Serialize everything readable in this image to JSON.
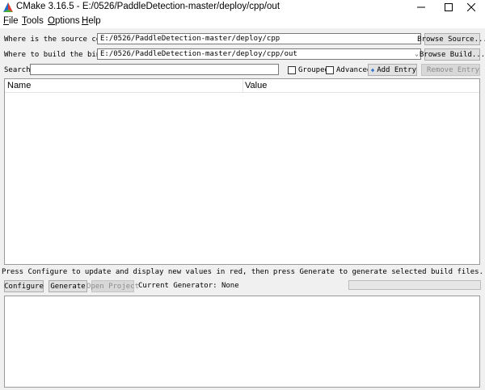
{
  "window": {
    "title": "CMake 3.16.5 - E:/0526/PaddleDetection-master/deploy/cpp/out",
    "icon": "cmake-triangle-icon"
  },
  "menu": {
    "items": [
      {
        "label": "File",
        "accel": "F",
        "rest": "ile"
      },
      {
        "label": "Tools",
        "accel": "T",
        "rest": "ools"
      },
      {
        "label": "Options",
        "accel": "O",
        "rest": "ptions"
      },
      {
        "label": "Help",
        "accel": "H",
        "rest": "elp"
      }
    ]
  },
  "source": {
    "label": "Where is the source code:",
    "value": "E:/0526/PaddleDetection-master/deploy/cpp",
    "browse_label": "Browse Source..."
  },
  "build": {
    "label": "Where to build the binaries:",
    "value": "E:/0526/PaddleDetection-master/deploy/cpp/out",
    "browse_label": "Browse Build..."
  },
  "search": {
    "label": "Search:",
    "value": "",
    "grouped_label": "Grouped",
    "grouped_checked": false,
    "advanced_label": "Advanced",
    "advanced_checked": false,
    "add_entry_label": "Add Entry",
    "remove_entry_label": "Remove Entry"
  },
  "table": {
    "columns": [
      "Name",
      "Value"
    ],
    "rows": []
  },
  "hint": "Press Configure to update and display new values in red, then press Generate to generate selected build files.",
  "actions": {
    "configure_label": "Configure",
    "generate_label": "Generate",
    "open_project_label": "Open Project",
    "current_generator": "Current Generator: None"
  },
  "progress": 0,
  "output": {
    "text": ""
  },
  "colors": {
    "accent": "#0078d7",
    "cmake_red": "#e03c31",
    "cmake_blue": "#1e68c7",
    "cmake_green": "#3eae2b"
  }
}
